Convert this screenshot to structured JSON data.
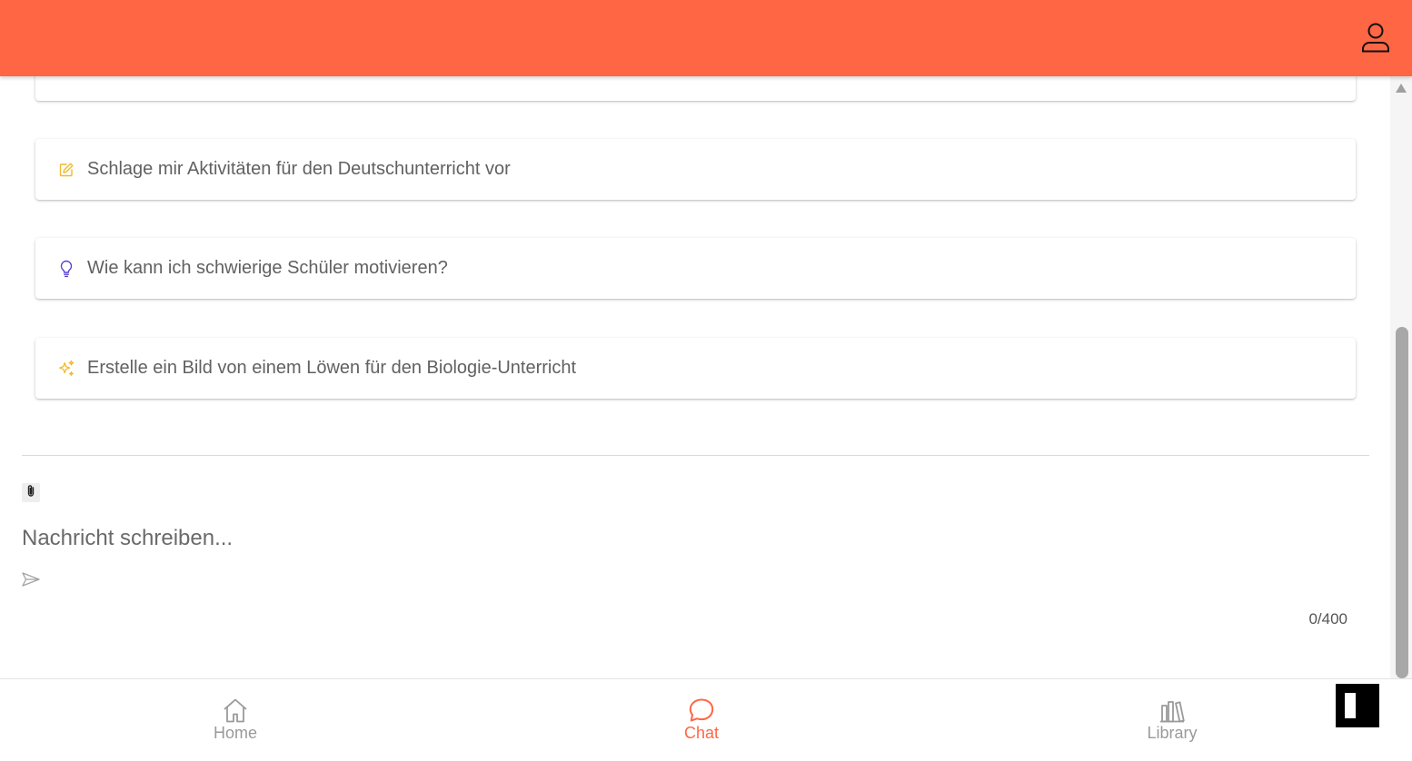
{
  "suggestions": [
    {
      "icon": "edit-square-icon",
      "label": "Schlage mir Aktivitäten für den Deutschunterricht vor",
      "color": "#f2b92a"
    },
    {
      "icon": "lightbulb-icon",
      "label": "Wie kann ich schwierige Schüler motivieren?",
      "color": "#5b3fd1"
    },
    {
      "icon": "sparkles-icon",
      "label": "Erstelle ein Bild von einem Löwen für den Biologie-Unterricht",
      "color": "#f2b92a"
    }
  ],
  "composer": {
    "placeholder": "Nachricht schreiben...",
    "value": "",
    "counter": "0/400"
  },
  "nav": {
    "home_label": "Home",
    "chat_label": "Chat",
    "library_label": "Library",
    "active": "chat"
  },
  "colors": {
    "brand": "#ff6644",
    "inactive_nav": "#9a9a9a"
  }
}
